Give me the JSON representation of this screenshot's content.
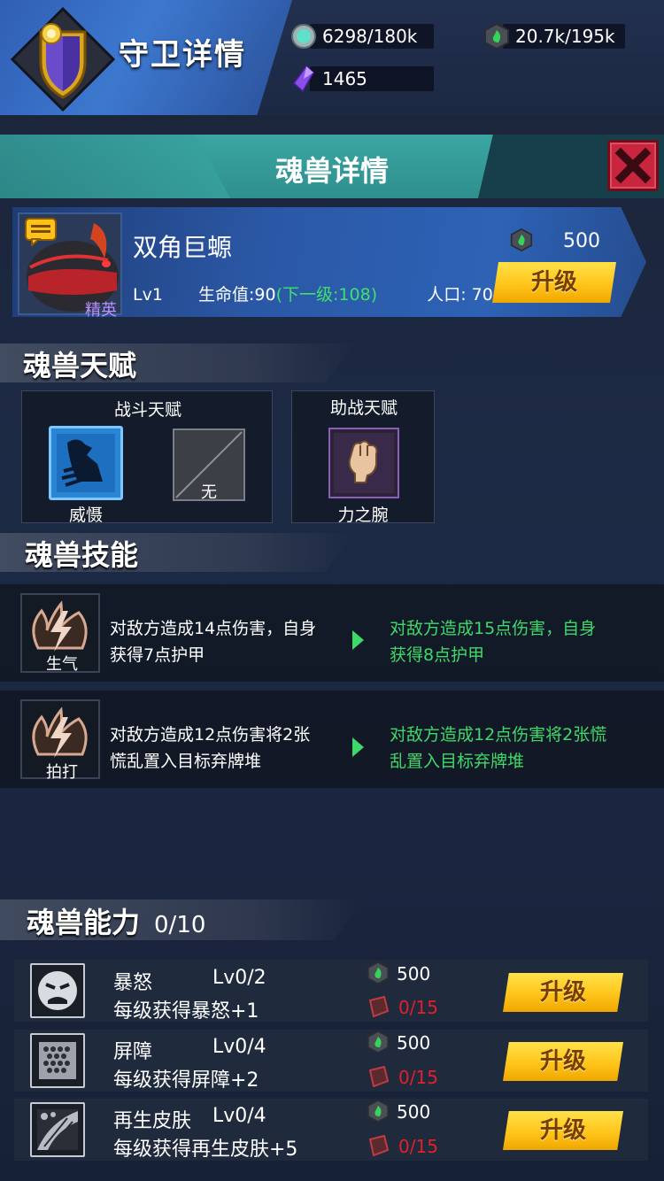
{
  "header": {
    "page_title": "守卫详情",
    "resources": [
      {
        "icon": "silver-coin-icon",
        "value": "6298/180k"
      },
      {
        "icon": "green-soul-gem-icon",
        "value": "20.7k/195k"
      },
      {
        "icon": "purple-crystal-icon",
        "value": "1465"
      }
    ]
  },
  "detail": {
    "title": "魂兽详情",
    "close_label": "close"
  },
  "monster": {
    "name": "双角巨螈",
    "rank": "精英",
    "level": "Lv1",
    "hp_label": "生命值:90",
    "hp_next": "(下一级:108)",
    "population": "人口: 70",
    "upgrade_cost": "500",
    "upgrade_label": "升级"
  },
  "talents": {
    "section_title": "魂兽天赋",
    "combat": {
      "title": "战斗天赋",
      "items": [
        {
          "label": "威慑",
          "icon": "intimidate-icon"
        },
        {
          "label": "无",
          "icon": "empty-slot-icon"
        }
      ]
    },
    "support": {
      "title": "助战天赋",
      "items": [
        {
          "label": "力之腕",
          "icon": "fist-icon"
        }
      ]
    }
  },
  "skills": {
    "section_title": "魂兽技能",
    "items": [
      {
        "name": "生气",
        "current_line1": "对敌方造成14点伤害，自身",
        "current_line2": "获得7点护甲",
        "next_line1": "对敌方造成15点伤害，自身",
        "next_line2": "获得8点护甲"
      },
      {
        "name": "拍打",
        "current_line1": "对敌方造成12点伤害将2张",
        "current_line2": "慌乱置入目标弃牌堆",
        "next_line1": "对敌方造成12点伤害将2张慌",
        "next_line2": "乱置入目标弃牌堆"
      }
    ]
  },
  "abilities": {
    "section_title": "魂兽能力",
    "progress": "0/10",
    "items": [
      {
        "name": "暴怒",
        "level": "Lv0/2",
        "desc": "每级获得暴怒+1",
        "cost": "500",
        "material": "0/15",
        "button": "升级",
        "icon": "rage-face-icon"
      },
      {
        "name": "屏障",
        "level": "Lv0/4",
        "desc": "每级获得屏障+2",
        "cost": "500",
        "material": "0/15",
        "button": "升级",
        "icon": "barrier-grid-icon"
      },
      {
        "name": "再生皮肤",
        "level": "Lv0/4",
        "desc": "每级获得再生皮肤+5",
        "cost": "500",
        "material": "0/15",
        "button": "升级",
        "icon": "regen-skin-icon"
      }
    ]
  },
  "colors": {
    "accent_green": "#3fd96a",
    "material_red": "#e2202a",
    "header_teal": "#3aa6a3",
    "button_gold": "#ffc51a"
  }
}
